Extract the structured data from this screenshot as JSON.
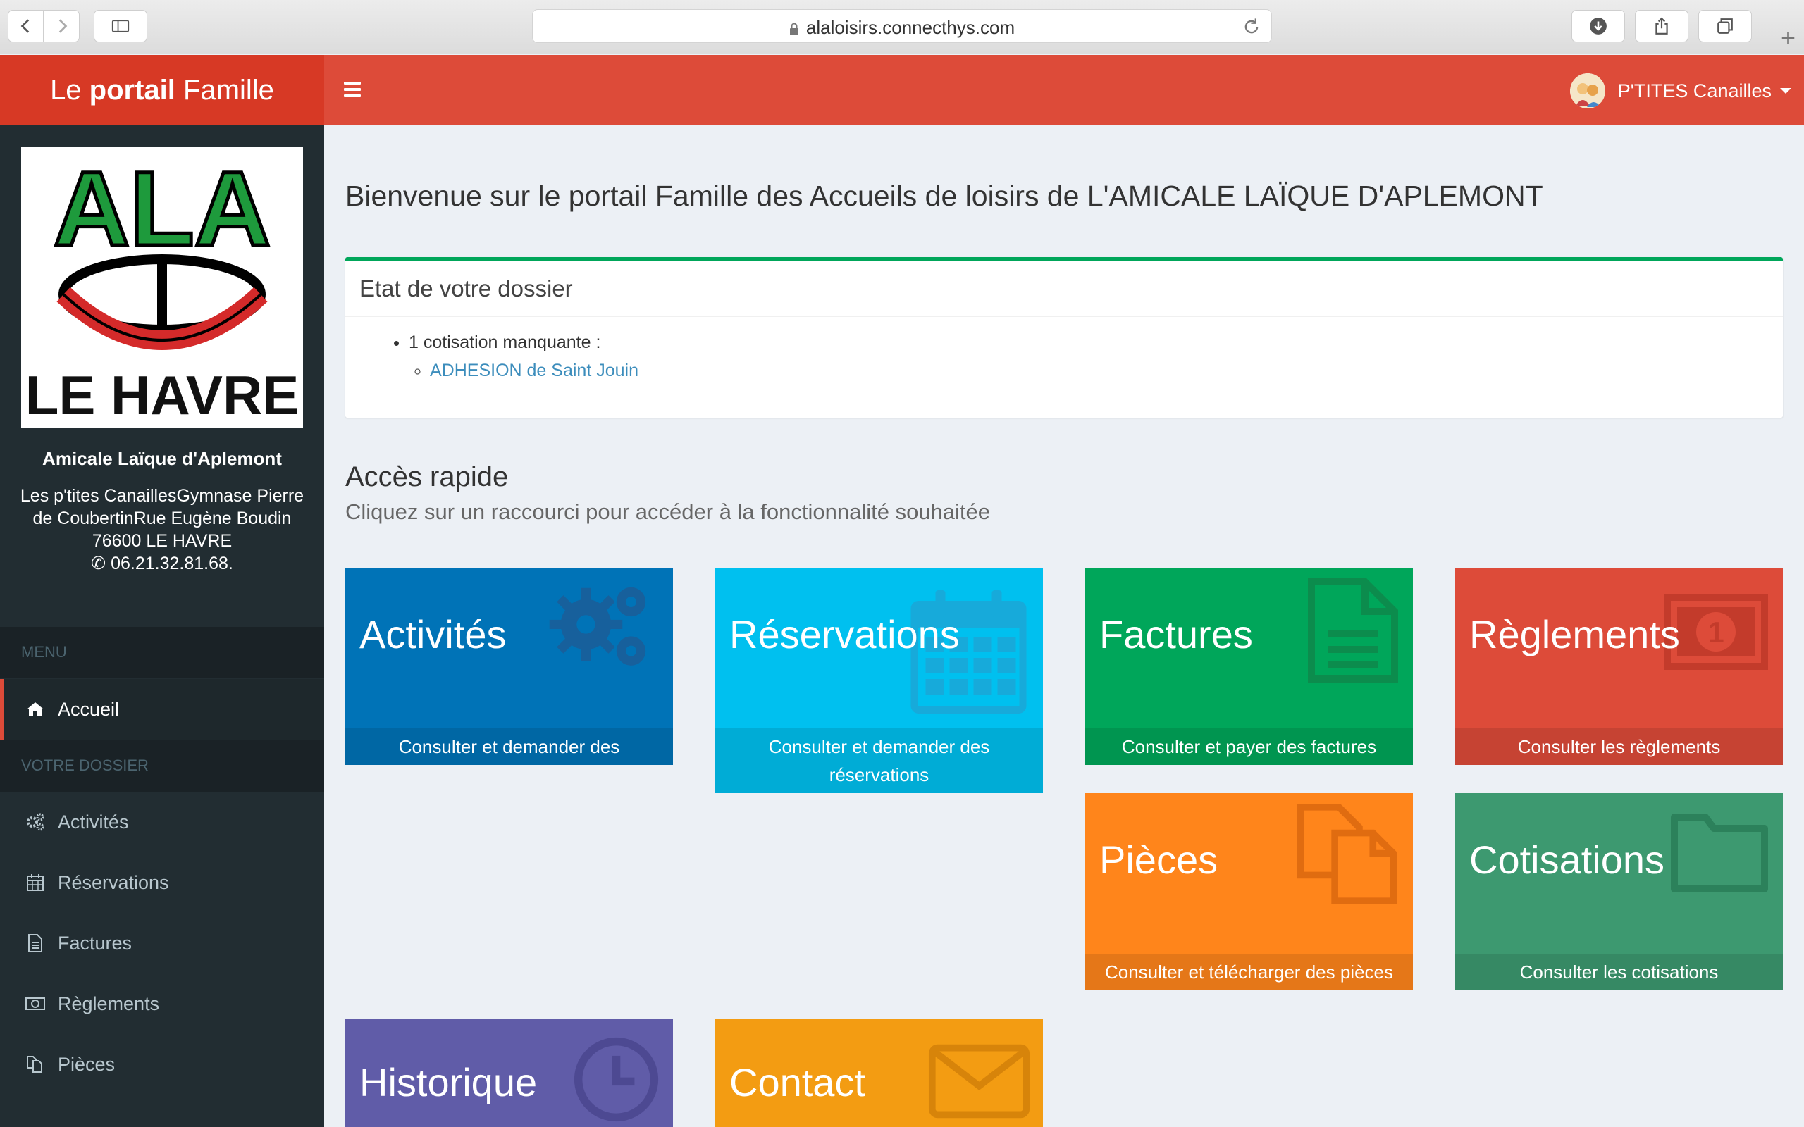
{
  "browser": {
    "url": "alaloisirs.connecthys.com"
  },
  "header": {
    "logo_pre": "Le ",
    "logo_bold": "portail",
    "logo_post": " Famille",
    "user_name": "P'TITES Canailles"
  },
  "sidebar": {
    "org_name": "Amicale Laïque d'Aplemont",
    "org_addr_line1": "Les p'tites CanaillesGymnase Pierre de CoubertinRue Eugène Boudin",
    "org_addr_line2": "76600 LE HAVRE",
    "org_phone": "06.21.32.81.68.",
    "menu_label": "MENU",
    "dossier_label": "VOTRE DOSSIER",
    "items": {
      "accueil": "Accueil",
      "activites": "Activités",
      "reservations": "Réservations",
      "factures": "Factures",
      "reglements": "Règlements",
      "pieces": "Pièces"
    }
  },
  "main": {
    "welcome": "Bienvenue sur le portail Famille des Accueils de loisirs de L'AMICALE LAÏQUE D'APLEMONT",
    "dossier": {
      "title": "Etat de votre dossier",
      "item": "1 cotisation manquante :",
      "subitem": "ADHESION de Saint Jouin"
    },
    "quick_title": "Accès rapide",
    "quick_sub": "Cliquez sur un raccourci pour accéder à la fonctionnalité souhaitée",
    "tiles": {
      "activites": {
        "label": "Activités",
        "footer": "Consulter et demander des inscriptions",
        "color": "#0073b7"
      },
      "reservations": {
        "label": "Réservations",
        "footer": "Consulter et demander des réservations",
        "color": "#00c0ef"
      },
      "factures": {
        "label": "Factures",
        "footer": "Consulter et payer des factures",
        "color": "#00a65a"
      },
      "reglements": {
        "label": "Règlements",
        "footer": "Consulter les règlements",
        "color": "#dd4b39"
      },
      "pieces": {
        "label": "Pièces",
        "footer": "Consulter et télécharger des pièces",
        "color": "#ff851b"
      },
      "cotisations": {
        "label": "Cotisations",
        "footer": "Consulter les cotisations",
        "color": "#3d9970"
      },
      "historique": {
        "label": "Historique",
        "color": "#605ca8"
      },
      "contact": {
        "label": "Contact",
        "color": "#f39c12"
      }
    }
  }
}
